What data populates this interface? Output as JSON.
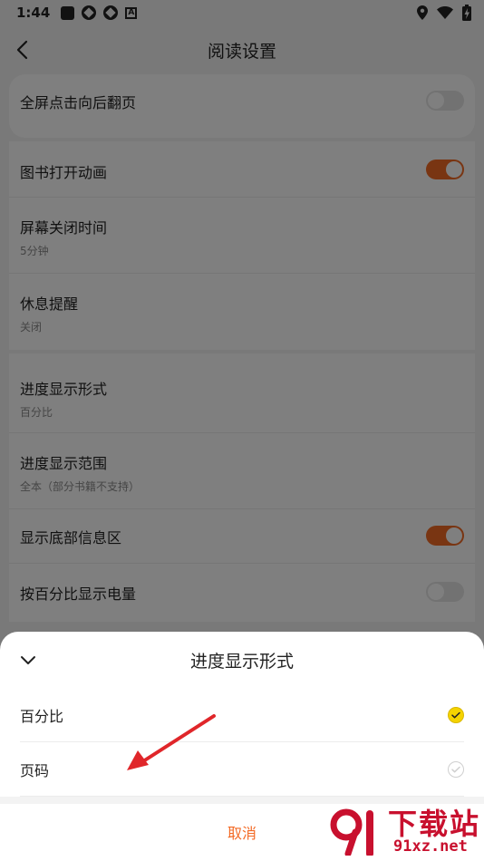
{
  "status_bar": {
    "time": "1:44",
    "left_icons": [
      "app-square-icon",
      "app-round-icon",
      "app-round-icon",
      "a-badge-icon"
    ],
    "right_icons": [
      "location-icon",
      "wifi-icon",
      "battery-charging-icon"
    ]
  },
  "nav": {
    "title": "阅读设置",
    "back_icon": "back-chevron-icon"
  },
  "settings": {
    "full_screen_tap": {
      "label": "全屏点击向后翻页",
      "enabled": false
    },
    "book_open_animation": {
      "label": "图书打开动画",
      "enabled": true
    },
    "screen_off_time": {
      "label": "屏幕关闭时间",
      "value": "5分钟"
    },
    "rest_reminder": {
      "label": "休息提醒",
      "value": "关闭"
    },
    "progress_format": {
      "label": "进度显示形式",
      "value": "百分比"
    },
    "progress_range": {
      "label": "进度显示范围",
      "value": "全本（部分书籍不支持）"
    },
    "bottom_info": {
      "label": "显示底部信息区",
      "enabled": true
    },
    "battery_percent": {
      "label": "按百分比显示电量",
      "enabled": false
    }
  },
  "sheet": {
    "title": "进度显示形式",
    "collapse_icon": "chevron-down-icon",
    "options": [
      {
        "label": "百分比",
        "selected": true
      },
      {
        "label": "页码",
        "selected": false
      }
    ],
    "cancel_label": "取消"
  },
  "watermark": {
    "text_big": "下载站",
    "text_small": "91xz.net"
  },
  "colors": {
    "accent": "#f36a25",
    "selected": "#f5d300",
    "annotation_arrow": "#e0262a",
    "watermark": "#c8102e"
  }
}
